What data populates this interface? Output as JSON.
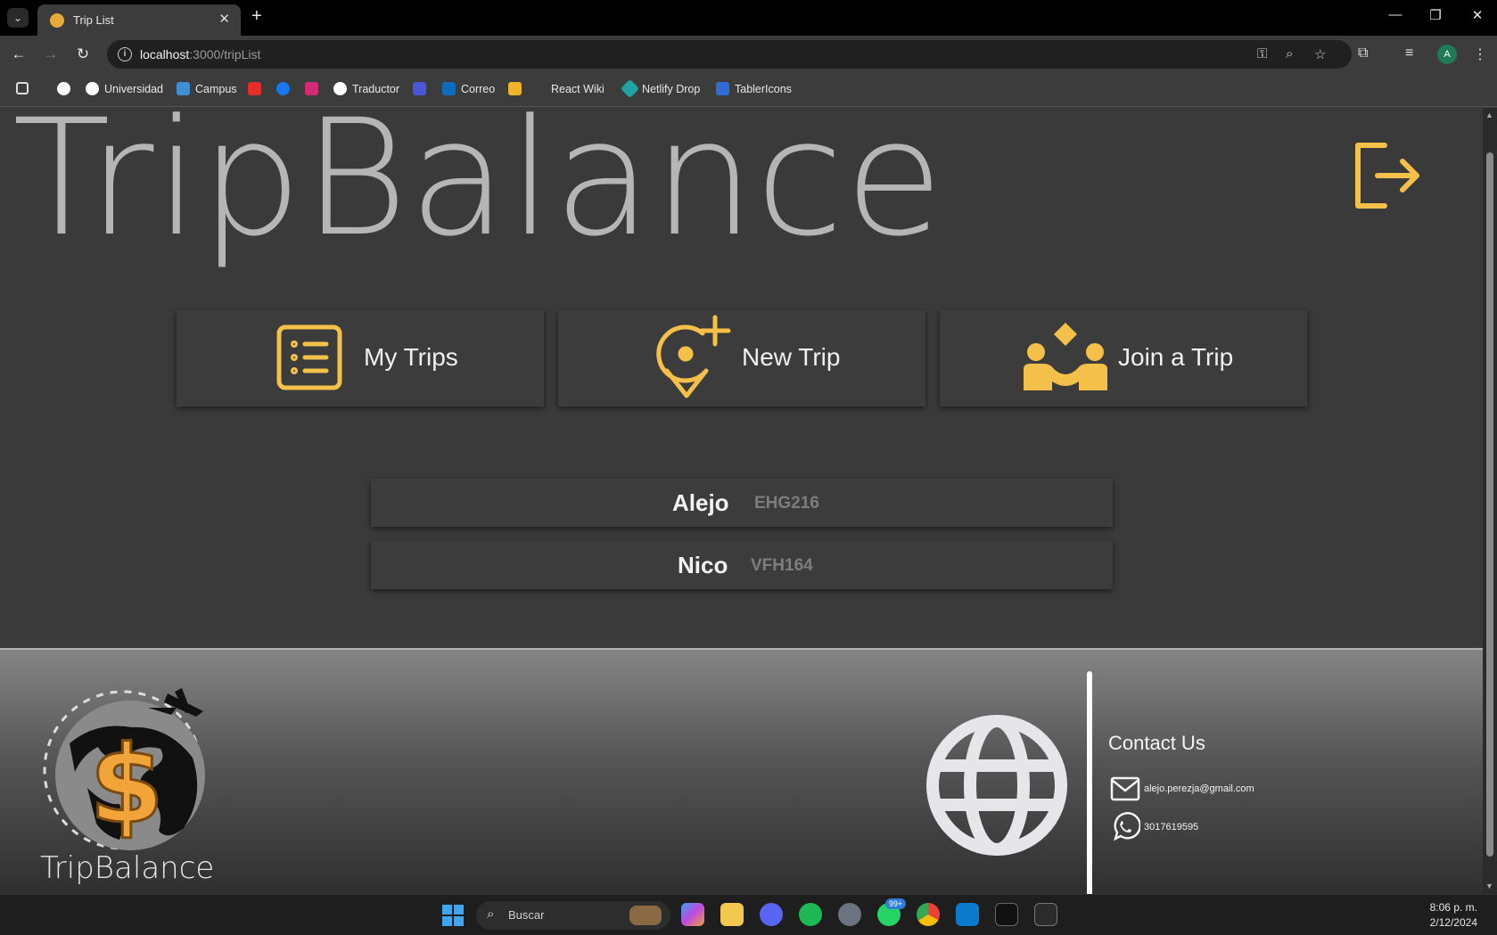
{
  "browser": {
    "tab_title": "Trip List",
    "url_host": "localhost",
    "url_path": ":3000/tripList",
    "profile_initial": "A",
    "bookmarks": [
      "Universidad",
      "Campus",
      "Traductor",
      "Correo",
      "React Wiki",
      "Netlify Drop",
      "TablerIcons"
    ]
  },
  "header": {
    "brand": "TripBalance"
  },
  "actions": [
    {
      "label": "My Trips",
      "icon": "list-details-icon"
    },
    {
      "label": "New Trip",
      "icon": "map-pin-plus-icon"
    },
    {
      "label": "Join a Trip",
      "icon": "users-handshake-icon"
    }
  ],
  "trips": [
    {
      "name": "Alejo",
      "code": "EHG216"
    },
    {
      "name": "Nico",
      "code": "VFH164"
    }
  ],
  "footer": {
    "brand": "TripBalance",
    "contact_title": "Contact Us",
    "email": "alejo.perezja@gmail.com",
    "phone": "3017619595"
  },
  "taskbar": {
    "search_placeholder": "Buscar",
    "badge": "99+",
    "time": "8:06 p. m.",
    "date": "2/12/2024"
  },
  "colors": {
    "accent": "#f5c04a",
    "page_bg": "#3a3a3a",
    "card_bg": "#3c3c3c"
  }
}
